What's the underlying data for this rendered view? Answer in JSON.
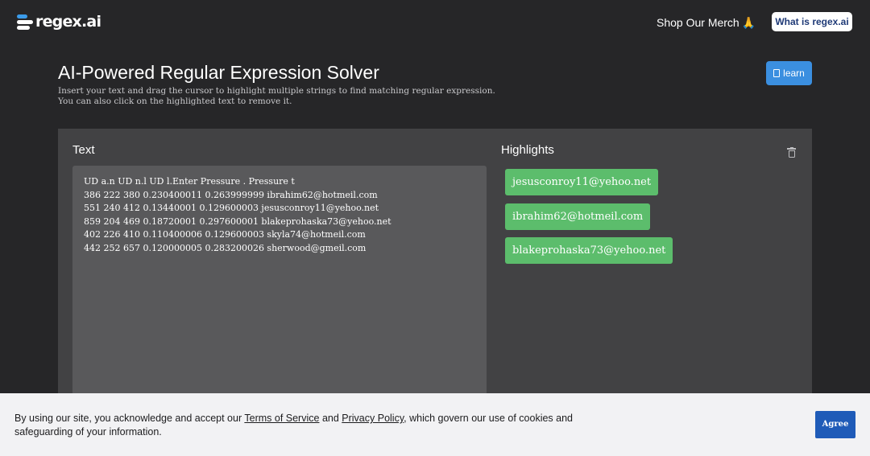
{
  "header": {
    "logo_text": "regex.ai",
    "merch_label": "Shop Our Merch",
    "merch_emoji": "🙏",
    "what_label": "What is regex.ai"
  },
  "page": {
    "title": "AI-Powered Regular Expression Solver",
    "subtitle_line1": "Insert your text and drag the cursor to highlight multiple strings to find matching regular expression.",
    "subtitle_line2": "You can also click on the highlighted text to remove it.",
    "learn_label": "learn"
  },
  "text_panel": {
    "label": "Text",
    "lines": [
      "UD a.n UD n.l UD l.Enter Pressure . Pressure t",
      "386 222 380 0.230400011 0.263999999 ibrahim62@hotmeil.com",
      "551 240 412 0.13440001 0.129600003 jesusconroy11@yehoo.net",
      "859 204 469 0.18720001 0.297600001 blakeprohaska73@yehoo.net",
      "402 226 410 0.110400006 0.129600003 skyla74@hotmeil.com",
      "442 252 657 0.120000005 0.283200026 sherwood@gmeil.com"
    ]
  },
  "highlights": {
    "label": "Highlights",
    "items": [
      "jesusconroy11@yehoo.net",
      "ibrahim62@hotmeil.com",
      "blakeprohaska73@yehoo.net"
    ]
  },
  "cookie": {
    "text_before": "By using our site, you acknowledge and accept our ",
    "terms_link": "Terms of Service",
    "text_and": " and ",
    "privacy_link": "Privacy Policy",
    "text_after": ", which govern our use of cookies and safeguarding of your information.",
    "agree_label": "Agree"
  },
  "colors": {
    "background": "#262628",
    "panel": "#424244",
    "text_area": "#59595b",
    "highlight_chip": "#5cbd6c",
    "learn_button": "#3b8fe0",
    "agree_button": "#1f5bb8",
    "logo_accent": "#3b9bea"
  }
}
